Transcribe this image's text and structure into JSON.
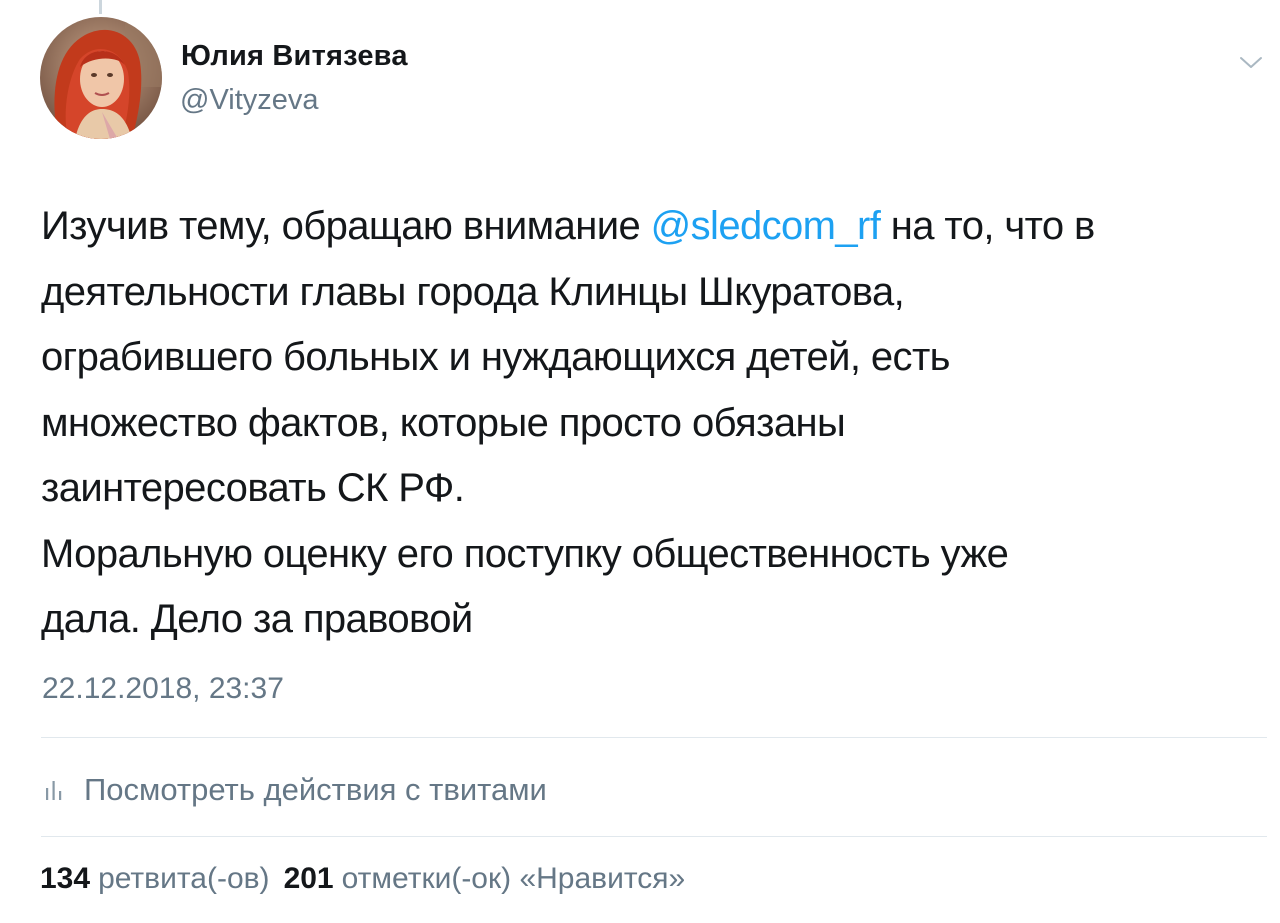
{
  "author": {
    "display_name": "Юлия Витязева",
    "handle": "@Vityzeva"
  },
  "tweet": {
    "lines": [
      {
        "before": "Изучив тему, обращаю внимание ",
        "mention": "@sledcom_rf",
        "after": " на то, что в"
      },
      {
        "text": "деятельности главы города Клинцы Шкуратова,"
      },
      {
        "text": "ограбившего больных и нуждающихся детей, есть"
      },
      {
        "text": "множество фактов, которые просто обязаны"
      },
      {
        "text": "заинтересовать СК РФ."
      },
      {
        "text": "Моральную оценку его поступку общественность уже"
      },
      {
        "text": "дала. Дело за правовой"
      }
    ],
    "timestamp": "22.12.2018, 23:37"
  },
  "activity": {
    "label": "Посмотреть действия с твитами",
    "icon": "analytics-icon"
  },
  "stats": {
    "retweets_count": "134",
    "retweets_label": "ретвита(-ов)",
    "likes_count": "201",
    "likes_label": "отметки(-ок) «Нравится»"
  },
  "icons": {
    "caret": "chevron-down-icon",
    "analytics": "analytics-icon",
    "avatar": "avatar"
  },
  "colors": {
    "link": "#1da1f2",
    "secondary_text": "#657786",
    "primary_text": "#14171a",
    "divider": "#e1e8ed"
  }
}
